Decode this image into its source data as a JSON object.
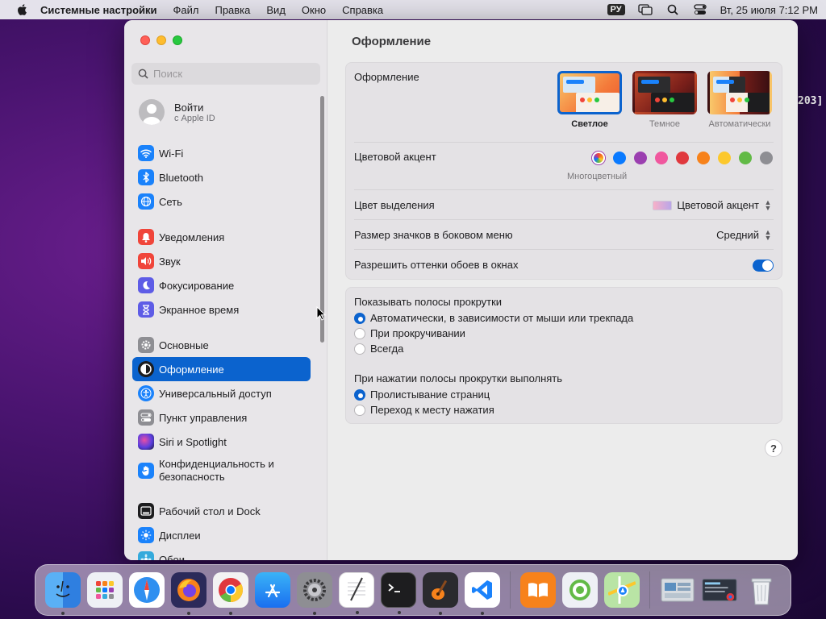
{
  "menubar": {
    "app_name": "Системные настройки",
    "items": [
      "Файл",
      "Правка",
      "Вид",
      "Окно",
      "Справка"
    ],
    "input_source": "РУ",
    "datetime": "Вт, 25 июля  7:12 PM"
  },
  "desktop": {
    "partial_text": "203]"
  },
  "sidebar": {
    "search_placeholder": "Поиск",
    "profile": {
      "name": "Войти",
      "sub": "с Apple ID"
    },
    "groups": [
      [
        {
          "label": "Wi‑Fi",
          "icon": "wifi-icon",
          "color": "#1a82fb"
        },
        {
          "label": "Bluetooth",
          "icon": "bluetooth-icon",
          "color": "#1a82fb"
        },
        {
          "label": "Сеть",
          "icon": "globe-icon",
          "color": "#1a82fb"
        }
      ],
      [
        {
          "label": "Уведомления",
          "icon": "bell-icon",
          "color": "#f0453a"
        },
        {
          "label": "Звук",
          "icon": "speaker-icon",
          "color": "#f0453a"
        },
        {
          "label": "Фокусирование",
          "icon": "moon-icon",
          "color": "#5e5ce6"
        },
        {
          "label": "Экранное время",
          "icon": "hourglass-icon",
          "color": "#5e5ce6"
        }
      ],
      [
        {
          "label": "Основные",
          "icon": "gear-icon",
          "color": "#8e8e93"
        },
        {
          "label": "Оформление",
          "icon": "appearance-icon",
          "color": "#1d1d1f",
          "active": true
        },
        {
          "label": "Универсальный доступ",
          "icon": "accessibility-icon",
          "color": "#1a82fb"
        },
        {
          "label": "Пункт управления",
          "icon": "control-center-icon",
          "color": "#8e8e93"
        },
        {
          "label": "Siri и Spotlight",
          "icon": "siri-icon",
          "color": "#6b3fd1"
        },
        {
          "label": "Конфиденциальность и безопасность",
          "icon": "hand-icon",
          "color": "#1a82fb"
        }
      ],
      [
        {
          "label": "Рабочий стол и Dock",
          "icon": "dock-icon",
          "color": "#1d1d1f"
        },
        {
          "label": "Дисплеи",
          "icon": "sun-icon",
          "color": "#1a82fb"
        },
        {
          "label": "Обои",
          "icon": "wallpaper-icon",
          "color": "#35aadc"
        }
      ]
    ]
  },
  "main": {
    "title": "Оформление",
    "appearance": {
      "label": "Оформление",
      "options": [
        {
          "label": "Светлое",
          "selected": true
        },
        {
          "label": "Темное",
          "selected": false
        },
        {
          "label": "Автоматически",
          "selected": false
        }
      ]
    },
    "accent": {
      "label": "Цветовой акцент",
      "selected_name": "Многоцветный",
      "colors": [
        "multicolor",
        "#0a7aff",
        "#9b3fb0",
        "#f0579e",
        "#e0383e",
        "#f7821b",
        "#fcc82d",
        "#62ba46",
        "#8e8e93"
      ]
    },
    "highlight": {
      "label": "Цвет выделения",
      "value": "Цветовой акцент"
    },
    "sidebar_icon_size": {
      "label": "Размер значков в боковом меню",
      "value": "Средний"
    },
    "wallpaper_tint": {
      "label": "Разрешить оттенки обоев в окнах",
      "enabled": true
    },
    "scrollbars": {
      "label": "Показывать полосы прокрутки",
      "options": [
        {
          "label": "Автоматически, в зависимости от мыши или трекпада",
          "selected": true
        },
        {
          "label": "При прокручивании",
          "selected": false
        },
        {
          "label": "Всегда",
          "selected": false
        }
      ]
    },
    "scroll_click": {
      "label": "При нажатии полосы прокрутки выполнять",
      "options": [
        {
          "label": "Пролистывание страниц",
          "selected": true
        },
        {
          "label": "Переход к месту нажатия",
          "selected": false
        }
      ]
    },
    "help": "?"
  },
  "dock": {
    "apps": [
      {
        "name": "finder-icon",
        "running": true
      },
      {
        "name": "launchpad-icon",
        "running": false
      },
      {
        "name": "safari-icon",
        "running": false
      },
      {
        "name": "firefox-icon",
        "running": true
      },
      {
        "name": "chrome-icon",
        "running": true
      },
      {
        "name": "app-store-icon",
        "running": false
      },
      {
        "name": "system-settings-icon",
        "running": true
      },
      {
        "name": "textedit-icon",
        "running": true
      },
      {
        "name": "terminal-icon",
        "running": true
      },
      {
        "name": "garageband-icon",
        "running": true
      },
      {
        "name": "vscode-icon",
        "running": true
      }
    ],
    "recent": [
      {
        "name": "books-icon",
        "running": false
      },
      {
        "name": "find-my-icon",
        "running": false
      },
      {
        "name": "maps-icon",
        "running": false
      }
    ],
    "stacks": [
      {
        "name": "downloads-stack-icon"
      },
      {
        "name": "window-thumbnail-icon"
      },
      {
        "name": "trash-icon"
      }
    ]
  }
}
